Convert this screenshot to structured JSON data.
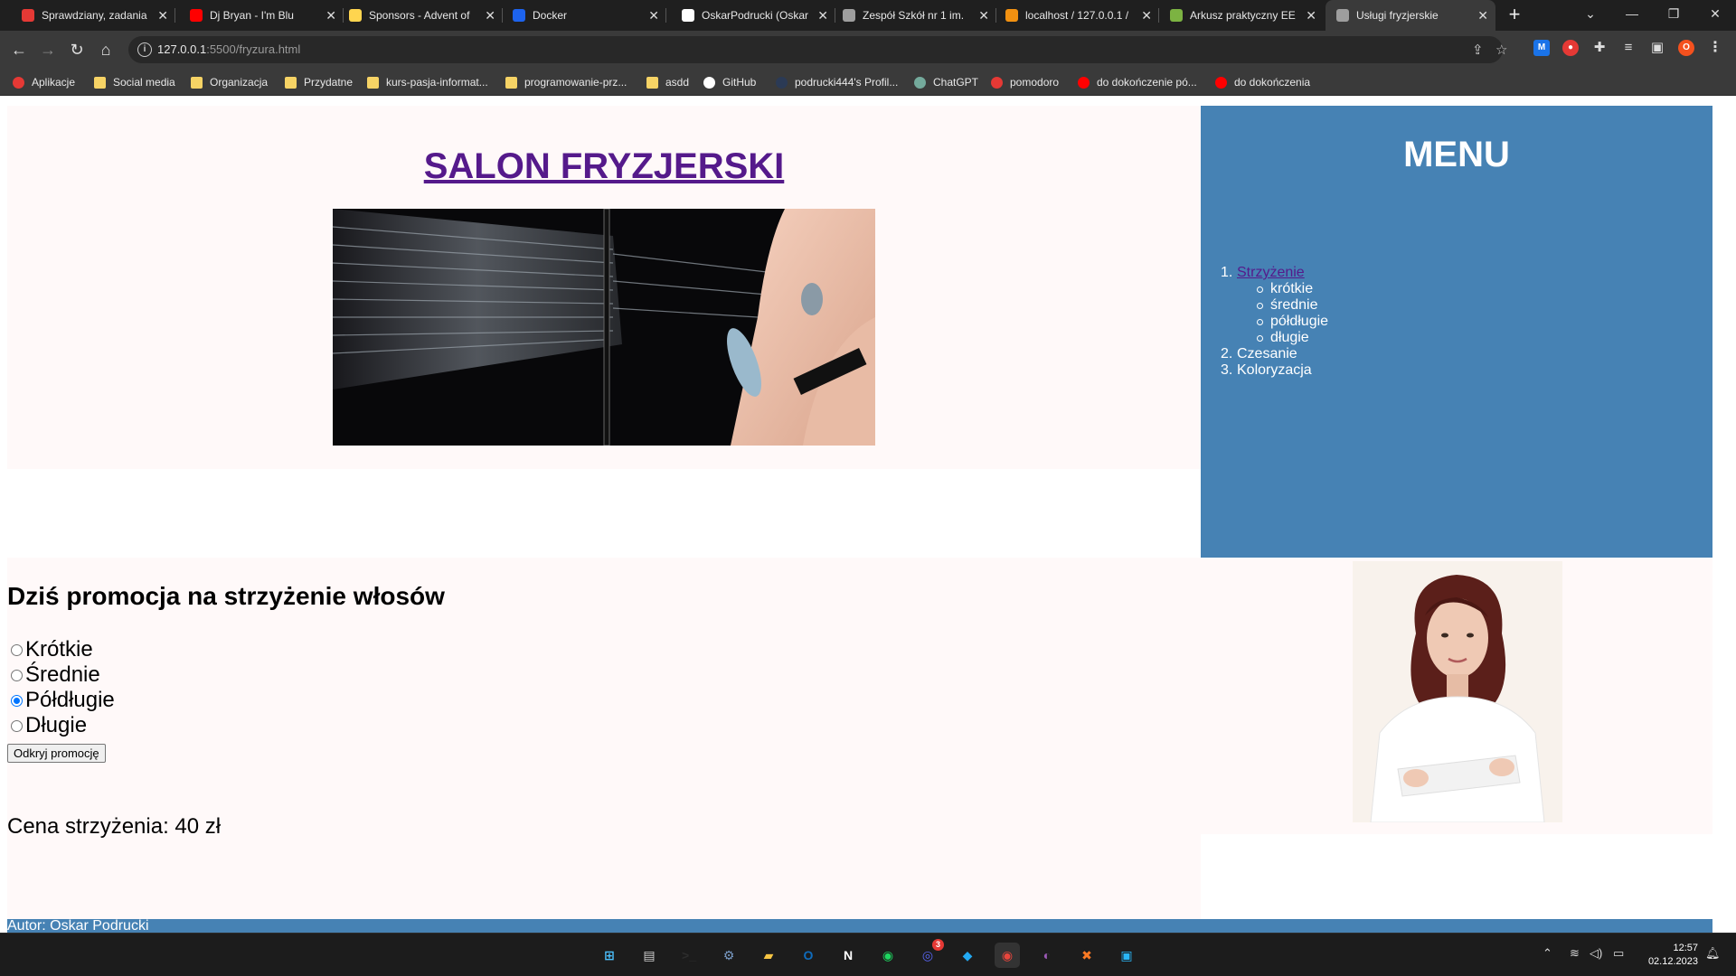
{
  "browser": {
    "tabs": [
      {
        "title": "Sprawdziany, zadania",
        "favicon": "red-square-icon",
        "color": "#e53935"
      },
      {
        "title": "Dj Bryan - I'm Blu",
        "favicon": "youtube-icon",
        "color": "#ff0000"
      },
      {
        "title": "Sponsors - Advent of",
        "favicon": "star-icon",
        "color": "#ffd54f"
      },
      {
        "title": "Docker",
        "favicon": "docker-icon",
        "color": "#1d63ed"
      },
      {
        "title": "OskarPodrucki (Oskar",
        "favicon": "github-icon",
        "color": "#ffffff"
      },
      {
        "title": "Zespół Szkół nr 1 im.",
        "favicon": "globe-icon",
        "color": "#9e9e9e"
      },
      {
        "title": "localhost / 127.0.0.1 /",
        "favicon": "phpmyadmin-icon",
        "color": "#f29111"
      },
      {
        "title": "Arkusz praktyczny EE",
        "favicon": "ep-icon",
        "color": "#7cb342"
      },
      {
        "title": "Usługi fryzjerskie",
        "favicon": "globe-icon",
        "color": "#9e9e9e"
      }
    ],
    "url_host": "127.0.0.1",
    "url_path": ":5500/fryzura.html",
    "bookmarks": [
      {
        "label": "Aplikacje",
        "icon": "apps-grid-icon",
        "color": "#e53935"
      },
      {
        "label": "Social media",
        "icon": "folder-icon",
        "color": "#f6d365"
      },
      {
        "label": "Organizacja",
        "icon": "folder-icon",
        "color": "#f6d365"
      },
      {
        "label": "Przydatne",
        "icon": "folder-icon",
        "color": "#f6d365"
      },
      {
        "label": "kurs-pasja-informat...",
        "icon": "folder-icon",
        "color": "#f6d365"
      },
      {
        "label": "programowanie-prz...",
        "icon": "folder-icon",
        "color": "#f6d365"
      },
      {
        "label": "asdd",
        "icon": "folder-icon",
        "color": "#f6d365"
      },
      {
        "label": "GitHub",
        "icon": "github-icon",
        "color": "#ffffff"
      },
      {
        "label": "podrucki444's Profil...",
        "icon": "profile-icon",
        "color": "#2b3a55"
      },
      {
        "label": "ChatGPT",
        "icon": "chatgpt-icon",
        "color": "#74aa9c"
      },
      {
        "label": "pomodoro",
        "icon": "pomodoro-icon",
        "color": "#e53935"
      },
      {
        "label": "do dokończenie pó...",
        "icon": "youtube-icon",
        "color": "#ff0000"
      },
      {
        "label": "do dokończenia",
        "icon": "youtube-icon",
        "color": "#ff0000"
      }
    ],
    "profile_initial": "O"
  },
  "page": {
    "site_title": "SALON FRYZJERSKI",
    "menu": {
      "title": "MENU",
      "items": [
        {
          "num": "1.",
          "label": "Strzyżenie",
          "sub": [
            "krótkie",
            "średnie",
            "półdługie",
            "długie"
          ]
        },
        {
          "num": "2.",
          "label": "Czesanie"
        },
        {
          "num": "3.",
          "label": "Koloryzacja"
        }
      ]
    },
    "promo": {
      "heading": "Dziś promocja na strzyżenie włosów",
      "options": [
        {
          "label": "Krótkie",
          "checked": false
        },
        {
          "label": "Średnie",
          "checked": false
        },
        {
          "label": "Półdługie",
          "checked": true
        },
        {
          "label": "Długie",
          "checked": false
        }
      ],
      "button": "Odkryj promocję",
      "price": "Cena strzyżenia: 40 zł"
    },
    "footer": "Autor: Oskar Podrucki",
    "colors": {
      "menu_bg": "#4682b4",
      "block_bg": "#fff9f9",
      "link": "#551a8b"
    }
  },
  "taskbar": {
    "apps": [
      "windows-start-icon",
      "task-view-icon",
      "terminal-icon",
      "settings-icon",
      "file-explorer-icon",
      "outlook-icon",
      "notion-icon",
      "spotify-icon",
      "discord-icon",
      "vscode-icon",
      "chrome-icon",
      "github-desktop-icon",
      "xampp-icon",
      "whiteboard-icon"
    ],
    "discord_badge": "3",
    "time": "12:57",
    "date": "02.12.2023"
  }
}
